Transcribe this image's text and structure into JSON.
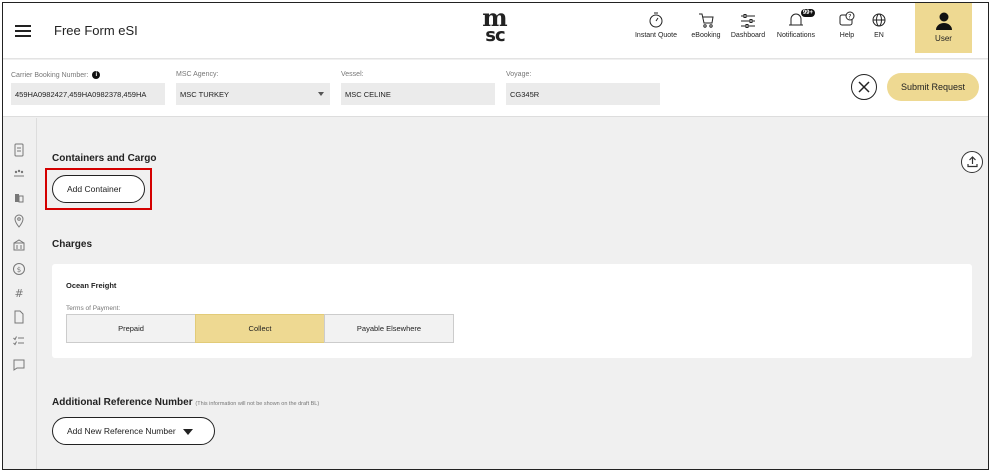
{
  "header": {
    "title": "Free Form eSI",
    "logo": {
      "line1": "m",
      "line2": "sc"
    },
    "nav": [
      {
        "label": "Instant Quote",
        "icon": "stopwatch-icon"
      },
      {
        "label": "eBooking",
        "icon": "cart-icon"
      },
      {
        "label": "Dashboard",
        "icon": "sliders-icon"
      },
      {
        "label": "Notifications",
        "icon": "bell-icon",
        "badge": "99+"
      },
      {
        "label": "Help",
        "icon": "help-icon"
      },
      {
        "label": "EN",
        "icon": "globe-icon"
      }
    ],
    "user_label": "User"
  },
  "booking": {
    "carrier_label": "Carrier Booking Number:",
    "carrier_info": "i",
    "carrier_value": "459HA0982427,459HA0982378,459HA",
    "agency_label": "MSC Agency:",
    "agency_value": "MSC TURKEY",
    "vessel_label": "Vessel:",
    "vessel_value": "MSC CELINE",
    "voyage_label": "Voyage:",
    "voyage_value": "CG345R",
    "submit_label": "Submit Request"
  },
  "containers": {
    "title": "Containers and Cargo",
    "add_label": "Add Container"
  },
  "charges": {
    "title": "Charges",
    "card_title": "Ocean Freight",
    "terms_label": "Terms of Payment:",
    "options": [
      "Prepaid",
      "Collect",
      "Payable Elsewhere"
    ],
    "selected": "Collect"
  },
  "reference": {
    "title": "Additional Reference Number",
    "note": "(This information will not be shown on the draft BL)",
    "add_label": "Add New Reference Number"
  },
  "colors": {
    "accent": "#eed992",
    "highlight": "#d40000"
  }
}
